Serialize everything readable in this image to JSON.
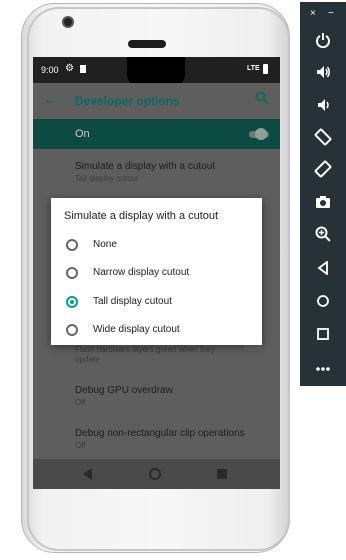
{
  "status_bar": {
    "time": "9:00",
    "network": "LTE"
  },
  "toolbar": {
    "title": "Developer options"
  },
  "master_switch": {
    "label": "On",
    "checked": true
  },
  "settings": [
    {
      "title": "Simulate a display with a cutout",
      "summary": "Tall display cutout"
    },
    {
      "title": "",
      "summary": "Flash hardware layers green when they update"
    },
    {
      "title": "Debug GPU overdraw",
      "summary": "Off"
    },
    {
      "title": "Debug non-rectangular clip operations",
      "summary": "Off"
    }
  ],
  "dialog": {
    "title": "Simulate a display with a cutout",
    "options": [
      {
        "label": "None",
        "selected": false
      },
      {
        "label": "Narrow display cutout",
        "selected": false
      },
      {
        "label": "Tall display cutout",
        "selected": true
      },
      {
        "label": "Wide display cutout",
        "selected": false
      }
    ]
  },
  "emulator_panel": {
    "window_controls": [
      "×",
      "−"
    ],
    "buttons": [
      "power",
      "volume-up",
      "volume-down",
      "rotate-left",
      "rotate-right",
      "screenshot",
      "zoom",
      "back",
      "home",
      "overview",
      "more"
    ]
  },
  "colors": {
    "accent": "#009e8c",
    "toolbar_text": "#0c6b5e",
    "panel_bg": "#263238"
  }
}
